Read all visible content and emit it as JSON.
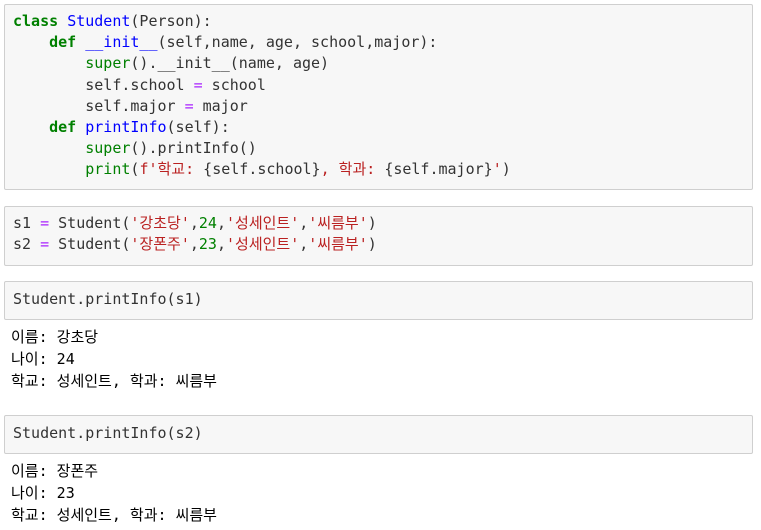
{
  "cells": [
    {
      "lines": [
        [
          {
            "cls": "k",
            "t": "class"
          },
          {
            "cls": "p",
            "t": " "
          },
          {
            "cls": "nc",
            "t": "Student"
          },
          {
            "cls": "p",
            "t": "(Person):"
          }
        ],
        [
          {
            "cls": "p",
            "t": "    "
          },
          {
            "cls": "k",
            "t": "def"
          },
          {
            "cls": "p",
            "t": " "
          },
          {
            "cls": "nf",
            "t": "__init__"
          },
          {
            "cls": "p",
            "t": "(self,name, age, school,major):"
          }
        ],
        [
          {
            "cls": "p",
            "t": "        "
          },
          {
            "cls": "nb",
            "t": "super"
          },
          {
            "cls": "p",
            "t": "()."
          },
          {
            "cls": "n",
            "t": "__init__"
          },
          {
            "cls": "p",
            "t": "(name, age)"
          }
        ],
        [
          {
            "cls": "p",
            "t": "        self.school "
          },
          {
            "cls": "o",
            "t": "="
          },
          {
            "cls": "p",
            "t": " school"
          }
        ],
        [
          {
            "cls": "p",
            "t": "        self.major "
          },
          {
            "cls": "o",
            "t": "="
          },
          {
            "cls": "p",
            "t": " major"
          }
        ],
        [
          {
            "cls": "p",
            "t": "    "
          },
          {
            "cls": "k",
            "t": "def"
          },
          {
            "cls": "p",
            "t": " "
          },
          {
            "cls": "nf",
            "t": "printInfo"
          },
          {
            "cls": "p",
            "t": "(self):"
          }
        ],
        [
          {
            "cls": "p",
            "t": "        "
          },
          {
            "cls": "nb",
            "t": "super"
          },
          {
            "cls": "p",
            "t": "().printInfo()"
          }
        ],
        [
          {
            "cls": "p",
            "t": "        "
          },
          {
            "cls": "nb",
            "t": "print"
          },
          {
            "cls": "p",
            "t": "("
          },
          {
            "cls": "s",
            "t": "f'학교: "
          },
          {
            "cls": "si",
            "t": "{self.school}"
          },
          {
            "cls": "s",
            "t": ", 학과: "
          },
          {
            "cls": "si",
            "t": "{self.major}"
          },
          {
            "cls": "s",
            "t": "'"
          },
          {
            "cls": "p",
            "t": ")"
          }
        ]
      ]
    },
    {
      "lines": [
        [
          {
            "cls": "p",
            "t": "s1 "
          },
          {
            "cls": "o",
            "t": "="
          },
          {
            "cls": "p",
            "t": " Student("
          },
          {
            "cls": "s",
            "t": "'강초당'"
          },
          {
            "cls": "p",
            "t": ","
          },
          {
            "cls": "mi",
            "t": "24"
          },
          {
            "cls": "p",
            "t": ","
          },
          {
            "cls": "s",
            "t": "'성세인트'"
          },
          {
            "cls": "p",
            "t": ","
          },
          {
            "cls": "s",
            "t": "'씨름부'"
          },
          {
            "cls": "p",
            "t": ")"
          }
        ],
        [
          {
            "cls": "p",
            "t": "s2 "
          },
          {
            "cls": "o",
            "t": "="
          },
          {
            "cls": "p",
            "t": " Student("
          },
          {
            "cls": "s",
            "t": "'장폰주'"
          },
          {
            "cls": "p",
            "t": ","
          },
          {
            "cls": "mi",
            "t": "23"
          },
          {
            "cls": "p",
            "t": ","
          },
          {
            "cls": "s",
            "t": "'성세인트'"
          },
          {
            "cls": "p",
            "t": ","
          },
          {
            "cls": "s",
            "t": "'씨름부'"
          },
          {
            "cls": "p",
            "t": ")"
          }
        ]
      ]
    },
    {
      "lines": [
        [
          {
            "cls": "p",
            "t": "Student.printInfo(s1)"
          }
        ]
      ]
    },
    {
      "lines": [
        [
          {
            "cls": "p",
            "t": "Student.printInfo(s2)"
          }
        ]
      ]
    }
  ],
  "outputs": [
    [
      "이름: 강초당",
      "나이: 24",
      "학교: 성세인트, 학과: 씨름부"
    ],
    [
      "이름: 장폰주",
      "나이: 23",
      "학교: 성세인트, 학과: 씨름부"
    ]
  ]
}
